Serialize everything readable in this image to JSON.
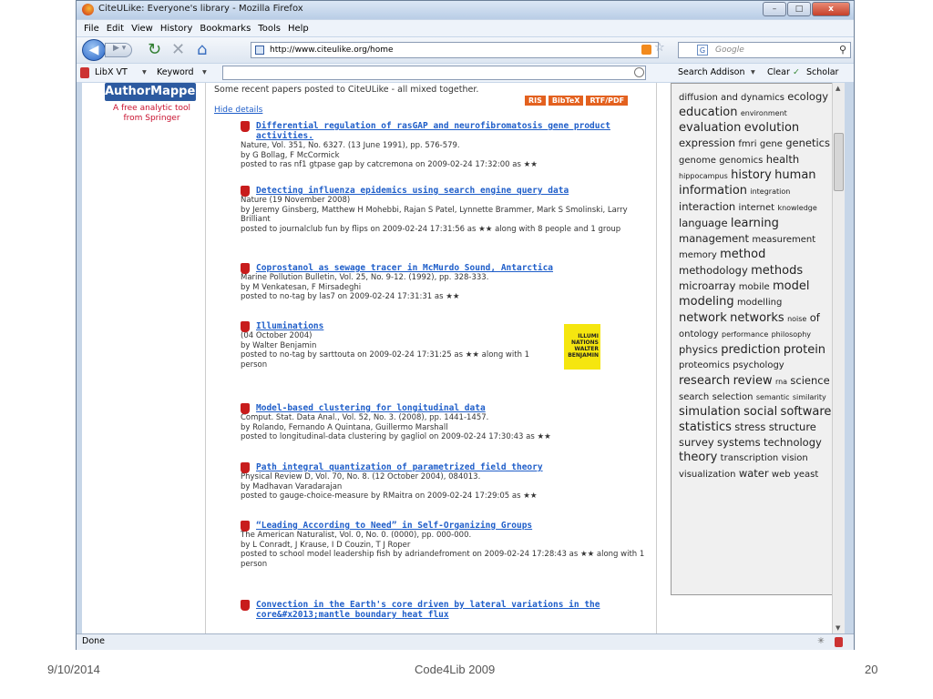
{
  "window": {
    "title": "CiteULike: Everyone's library - Mozilla Firefox",
    "minimize": "–",
    "maximize": "□",
    "close": "x"
  },
  "menu": [
    "File",
    "Edit",
    "View",
    "History",
    "Bookmarks",
    "Tools",
    "Help"
  ],
  "nav": {
    "url": "http://www.citeulike.org/home",
    "search_placeholder": "Google",
    "google_glyph": "G"
  },
  "libx": {
    "label": "LibX VT",
    "keyword": "Keyword",
    "search_addison": "Search Addison",
    "clear": "Clear",
    "scholar": "Scholar"
  },
  "ad": {
    "logo": "AuthorMapper",
    "line1": "A free analytic tool",
    "line2": "from Springer"
  },
  "main": {
    "intro": "Some recent papers posted to CiteULike - all mixed together.",
    "exports": [
      "RIS",
      "BibTeX",
      "RTF/PDF"
    ],
    "hide_details": "Hide details"
  },
  "papers": [
    {
      "title": "Differential regulation of rasGAP and neurofibromatosis gene product activities.",
      "source": "Nature, Vol. 351, No. 6327. (13 June 1991), pp. 576-579.",
      "by": "by G Bollag, F McCormick",
      "posted": "posted to ras nf1 gtpase gap by catcremona on 2009-02-24 17:32:00 as ★★"
    },
    {
      "title": "Detecting influenza epidemics using search engine query data",
      "source": "Nature (19 November 2008)",
      "by": "by Jeremy Ginsberg, Matthew H Mohebbi, Rajan S Patel, Lynnette Brammer, Mark S Smolinski, Larry Brilliant",
      "posted": "posted to journalclub fun by flips on 2009-02-24 17:31:56 as ★★ along with 8 people and 1 group"
    },
    {
      "title": "Coprostanol as sewage tracer in McMurdo Sound, Antarctica",
      "source": "Marine Pollution Bulletin, Vol. 25, No. 9-12. (1992), pp. 328-333.",
      "by": "by M Venkatesan, F Mirsadeghi",
      "posted": "posted to no-tag by las7 on 2009-02-24 17:31:31 as ★★"
    },
    {
      "title": "Illuminations",
      "source": "(04 October 2004)",
      "by": "by Walter Benjamin",
      "posted": "posted to no-tag by sarttouta on 2009-02-24 17:31:25 as ★★ along with 1 person"
    },
    {
      "title": "Model-based clustering for longitudinal data",
      "source": "Comput. Stat. Data Anal., Vol. 52, No. 3. (2008), pp. 1441-1457.",
      "by": "by Rolando, Fernando A Quintana, Guillermo Marshall",
      "posted": "posted to longitudinal-data clustering by gagliol on 2009-02-24 17:30:43 as ★★"
    },
    {
      "title": "Path integral quantization of parametrized field theory",
      "source": "Physical Review D, Vol. 70, No. 8. (12 October 2004), 084013.",
      "by": "by Madhavan Varadarajan",
      "posted": "posted to gauge-choice-measure by RMaitra on 2009-02-24 17:29:05 as ★★"
    },
    {
      "title": "“Leading According to Need” in Self-Organizing Groups",
      "source": "The American Naturalist, Vol. 0, No. 0. (0000), pp. 000-000.",
      "by": "by L Conradt, J Krause, I D Couzin, T J Roper",
      "posted": "posted to school model leadership fish by adriandefroment on 2009-02-24 17:28:43 as ★★ along with 1 person"
    },
    {
      "title": "Convection in the Earth's core driven by lateral variations in the core&#x2013;mantle boundary heat flux",
      "source": "",
      "by": "",
      "posted": ""
    }
  ],
  "book_cover": "ILLUMI NATIONS WALTER BENJAMIN",
  "tags": [
    [
      "diffusion and dynamics",
      2
    ],
    [
      "ecology",
      3
    ],
    [
      "education",
      4
    ],
    [
      "environment",
      1
    ],
    [
      "evaluation",
      4
    ],
    [
      "evolution",
      4
    ],
    [
      "expression",
      3
    ],
    [
      "fmri",
      2
    ],
    [
      "gene",
      2
    ],
    [
      "genetics",
      3
    ],
    [
      "genome",
      2
    ],
    [
      "genomics",
      2
    ],
    [
      "health",
      3
    ],
    [
      "hippocampus",
      1
    ],
    [
      "history",
      4
    ],
    [
      "human",
      4
    ],
    [
      "information",
      4
    ],
    [
      "integration",
      1
    ],
    [
      "interaction",
      3
    ],
    [
      "internet",
      2
    ],
    [
      "knowledge",
      1
    ],
    [
      "language",
      3
    ],
    [
      "learning",
      4
    ],
    [
      "management",
      3
    ],
    [
      "measurement",
      2
    ],
    [
      "memory",
      2
    ],
    [
      "method",
      4
    ],
    [
      "methodology",
      3
    ],
    [
      "methods",
      4
    ],
    [
      "microarray",
      3
    ],
    [
      "mobile",
      2
    ],
    [
      "model",
      4
    ],
    [
      "modeling",
      4
    ],
    [
      "modelling",
      2
    ],
    [
      "network",
      4
    ],
    [
      "networks",
      4
    ],
    [
      "noise",
      1
    ],
    [
      "of",
      3
    ],
    [
      "ontology",
      2
    ],
    [
      "performance",
      1
    ],
    [
      "philosophy",
      1
    ],
    [
      "physics",
      3
    ],
    [
      "prediction",
      4
    ],
    [
      "protein",
      4
    ],
    [
      "proteomics",
      2
    ],
    [
      "psychology",
      2
    ],
    [
      "research",
      4
    ],
    [
      "review",
      4
    ],
    [
      "rna",
      1
    ],
    [
      "science",
      3
    ],
    [
      "search",
      2
    ],
    [
      "selection",
      2
    ],
    [
      "semantic",
      1
    ],
    [
      "similarity",
      1
    ],
    [
      "simulation",
      4
    ],
    [
      "social",
      4
    ],
    [
      "software",
      4
    ],
    [
      "statistics",
      4
    ],
    [
      "stress",
      3
    ],
    [
      "structure",
      3
    ],
    [
      "survey",
      3
    ],
    [
      "systems",
      3
    ],
    [
      "technology",
      3
    ],
    [
      "theory",
      4
    ],
    [
      "transcription",
      2
    ],
    [
      "vision",
      2
    ],
    [
      "visualization",
      2
    ],
    [
      "water",
      3
    ],
    [
      "web",
      2
    ],
    [
      "yeast",
      2
    ]
  ],
  "status": "Done",
  "footer": {
    "date": "9/10/2014",
    "center": "Code4Lib 2009",
    "page": "20"
  }
}
